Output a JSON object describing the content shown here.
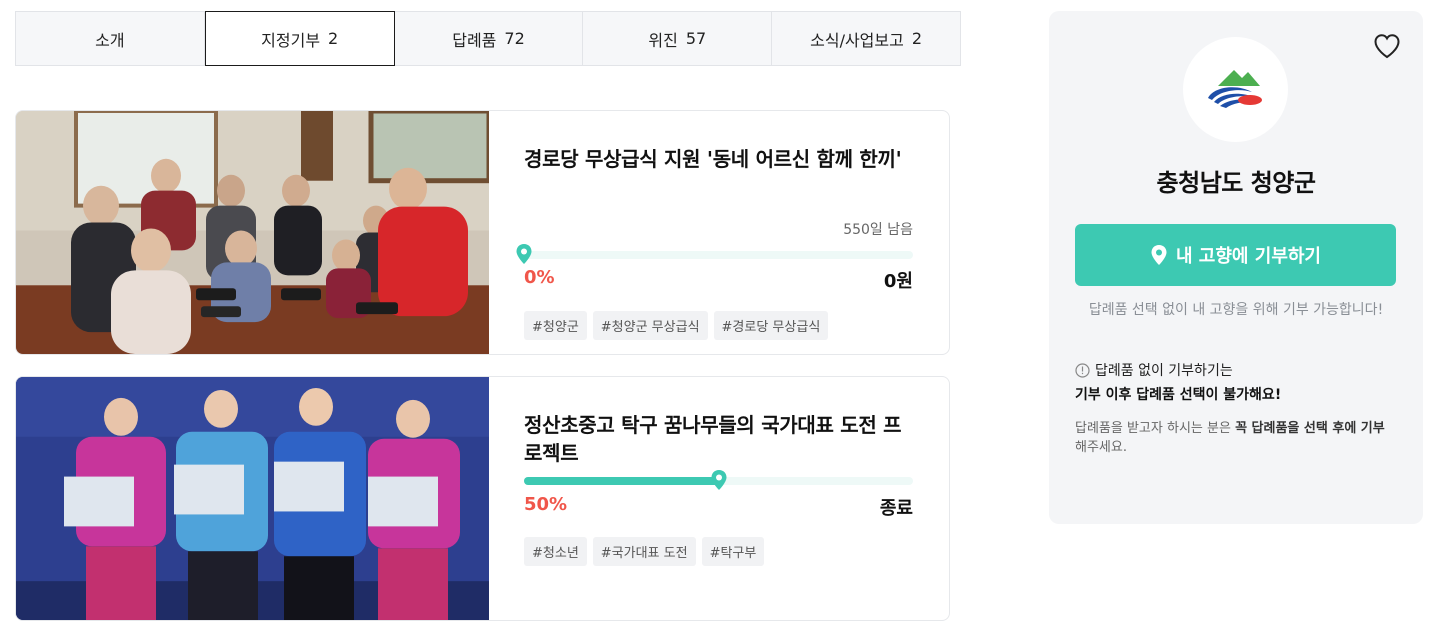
{
  "tabs": [
    {
      "label": "소개",
      "count": ""
    },
    {
      "label": "지정기부",
      "count": "2"
    },
    {
      "label": "답례품",
      "count": "72"
    },
    {
      "label": "위진",
      "count": "57"
    },
    {
      "label": "소식/사업보고",
      "count": "2"
    }
  ],
  "active_tab_index": 1,
  "projects": [
    {
      "title": "경로당 무상급식 지원 '동네 어르신 함께 한끼'",
      "remaining": "550일 남음",
      "progress": 0,
      "percent_label": "0%",
      "amount": "0원",
      "tags": [
        "#청양군",
        "#청양군 무상급식",
        "#경로당 무상급식"
      ]
    },
    {
      "title": "정산초중고 탁구 꿈나무들의 국가대표 도전 프로젝트",
      "remaining": "",
      "progress": 50,
      "percent_label": "50%",
      "amount": "종료",
      "tags": [
        "#청소년",
        "#국가대표 도전",
        "#탁구부"
      ]
    }
  ],
  "sidebar": {
    "region_name": "충청남도 청양군",
    "donate_button_label": "내 고향에 기부하기",
    "helper_text": "답례품 선택 없이 내 고향을 위해 기부 가능합니다!",
    "notice_title": "답례품 없이 기부하기는",
    "notice_warning": "기부 이후 답례품 선택이 불가해요!",
    "notice_desc_prefix": "답례품을 받고자 하시는 분은 ",
    "notice_desc_bold": "꼭 답례품을 선택 후에 기부",
    "notice_desc_suffix": "해주세요."
  },
  "colors": {
    "accent": "#3dc9b2",
    "percent": "#f0564a",
    "track": "#eef9f7"
  },
  "icons": {
    "favorite": "heart-outline-icon",
    "donate": "map-pin-icon",
    "notice": "info-circle-icon",
    "progress_marker": "map-pin-icon"
  }
}
